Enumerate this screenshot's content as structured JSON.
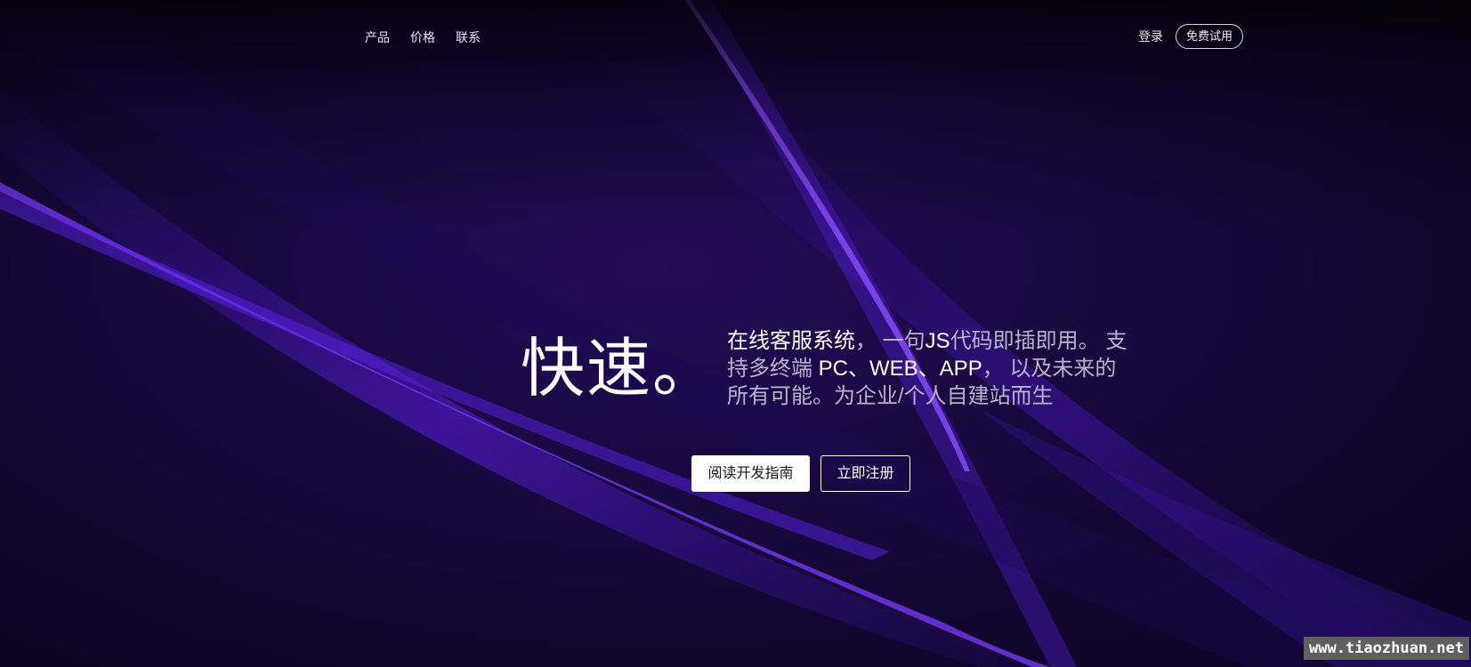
{
  "nav": {
    "links": [
      {
        "label": "产品"
      },
      {
        "label": "价格"
      },
      {
        "label": "联系"
      }
    ],
    "login_label": "登录",
    "trial_label": "免费试用"
  },
  "hero": {
    "title": "快速。",
    "desc_parts": [
      {
        "text": "在线客服系统",
        "highlight": true
      },
      {
        "text": "， ",
        "highlight": false
      },
      {
        "text": "一句",
        "highlight": false
      },
      {
        "text": "JS",
        "highlight": true
      },
      {
        "text": "代码即插即用。 支持多终端 ",
        "highlight": false
      },
      {
        "text": "PC、WEB、APP",
        "highlight": true
      },
      {
        "text": "， 以及未来的所有可能。为企业/个人自建站而生",
        "highlight": false
      }
    ]
  },
  "actions": {
    "primary_label": "阅读开发指南",
    "secondary_label": "立即注册"
  },
  "watermark": {
    "text": "www.tiaozhuan.net"
  },
  "colors": {
    "background": "#12062e",
    "accent_purple": "#6a2cff",
    "text_muted": "#b9b2cb",
    "text_bright": "#ffffff"
  }
}
